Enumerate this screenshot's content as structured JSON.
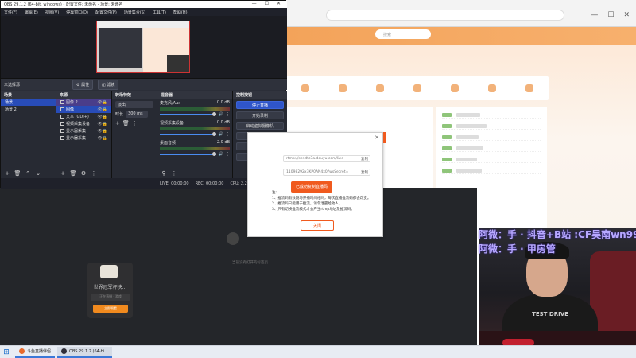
{
  "obs": {
    "title": "OBS 29.1.2 (64-bit, windows) - 配置文件: 未命名 - 场景: 未命名",
    "window_buttons": [
      "—",
      "☐",
      "✕"
    ],
    "menu": [
      "文件(F)",
      "编辑(E)",
      "视图(V)",
      "停靠窗口(D)",
      "配置文件(P)",
      "场景集合(S)",
      "工具(T)",
      "帮助(H)"
    ],
    "source_bar": {
      "no_source": "未选择源",
      "properties": "属性",
      "filters": "滤镜"
    },
    "scenes": {
      "title": "场景",
      "items": [
        "场景",
        "场景 2"
      ]
    },
    "sources": {
      "title": "来源",
      "items": [
        "图像 2",
        "图像",
        "文本 (GDI+)",
        "视频采集设备",
        "显示器采集",
        "显示器采集"
      ]
    },
    "transitions": {
      "title": "转场特效",
      "type": "淡出",
      "duration_label": "时长",
      "duration": "300 ms"
    },
    "mixer": {
      "title": "混音器",
      "channels": [
        {
          "name": "麦克风/Aux",
          "db": "0.0 dB",
          "level": 0.9
        },
        {
          "name": "视频采集设备",
          "db": "0.0 dB",
          "level": 0.9
        },
        {
          "name": "桌面音频",
          "db": "-2.0 dB",
          "level": 0.85
        }
      ]
    },
    "controls": {
      "title": "控制按钮",
      "buttons": [
        "停止直播",
        "开始录制",
        "启动虚拟摄像机",
        "工作室模式",
        "设置",
        "退出"
      ]
    },
    "status": {
      "live": "LIVE: 00:00:00",
      "rec": "REC: 00:00:00",
      "cpu": "CPU: 2.2%, 60.00 fps"
    }
  },
  "dialog": {
    "server": "rtmp://sendtc3a.douyu.com/live",
    "stream_key": "11098292x3KP0AN4x0?wsSecret=",
    "copy_label": "复制",
    "action_button": "已成功复制直播码",
    "notes_title": "注:",
    "notes": [
      "1、推流码有效期与开播时间相同，每次直播推流码都会改变。",
      "2、推流码只能用于推流，请勿泄露给他人。",
      "3、只有切换推流模式才会产生rtmp地址及推流码。"
    ],
    "close_button": "关闭"
  },
  "empty_area": {
    "message": "当前没有打开的标签页"
  },
  "card": {
    "title": "世界冠军杯决...",
    "subtitle": "正在直播 · 游戏",
    "button": "立即观看"
  },
  "site": {
    "search_placeholder": "搜索"
  },
  "overlay": {
    "line1": "阿微：手 · 抖音+B站 :CF吴南wn99",
    "line2": "阿微：手 · 甲房管"
  },
  "webcam": {
    "shirt_text": "TEST DRIVE"
  },
  "taskbar": {
    "start": "⊞",
    "items": [
      {
        "label": "斗鱼直播伴侣",
        "color": "#e86a2c"
      },
      {
        "label": "OBS 29.1.2 (64-bi...",
        "color": "#302f3a"
      }
    ]
  },
  "colors": {
    "accent": "#2f55c9",
    "orange": "#f05a1e",
    "obs_bg": "#2b2e38"
  }
}
